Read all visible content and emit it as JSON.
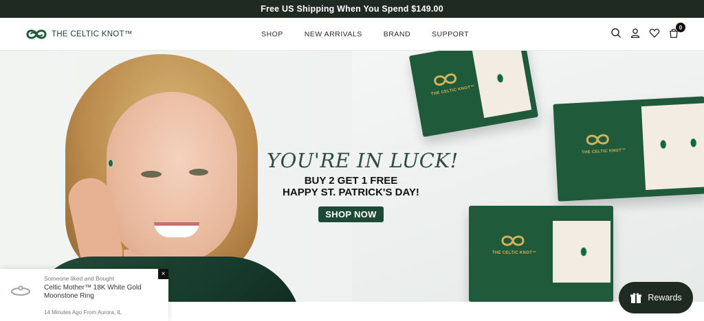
{
  "announcement": "Free US Shipping When You Spend $149.00",
  "brand": {
    "name": "THE CELTIC KNOT™",
    "box_text": "THE CELTIC KNOT™"
  },
  "nav": {
    "items": [
      "SHOP",
      "NEW ARRIVALS",
      "BRAND",
      "SUPPORT"
    ]
  },
  "header_icons": [
    "search-icon",
    "account-icon",
    "wishlist-icon",
    "cart-icon"
  ],
  "cart_count": "0",
  "hero": {
    "title": "YOU'RE IN LUCK!",
    "line1": "BUY 2 GET 1 FREE",
    "line2": "HAPPY ST. PATRICK'S DAY!",
    "button": "SHOP NOW"
  },
  "popup": {
    "subtitle": "Someone liked and Bought",
    "product": "Celtic Mother™ 18K White Gold Moonstone Ring",
    "meta": "14 Minutes Ago From Aurora, IL",
    "close": "×"
  },
  "rewards": {
    "label": "Rewards",
    "icon": "gift-icon"
  },
  "colors": {
    "dark_green": "#1f2a22",
    "box_green": "#1f5a3a",
    "brand_gold": "#d4b25b"
  }
}
